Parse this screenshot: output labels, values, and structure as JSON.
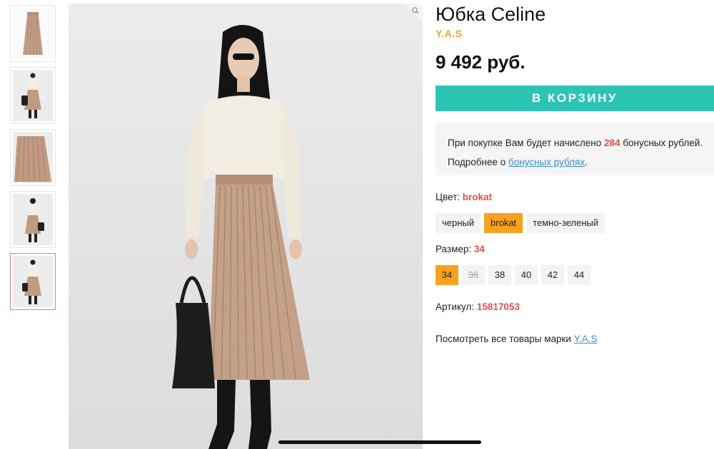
{
  "product": {
    "title": "Юбка Celine",
    "brand": "Y.A.S",
    "price": "9 492 руб.",
    "add_to_cart": "В КОРЗИНУ"
  },
  "bonus": {
    "line1_prefix": "При покупке Вам будет начислено",
    "points": "284",
    "line1_suffix": "бонусных рублей.",
    "line2_prefix": "Подробнее о",
    "line2_link": "бонусных рублях",
    "line2_suffix": "."
  },
  "color": {
    "label": "Цвет:",
    "selected": "brokat",
    "options": [
      "черный",
      "brokat",
      "темно-зеленый"
    ]
  },
  "size": {
    "label": "Размер:",
    "selected": "34",
    "options": [
      "34",
      "36",
      "38",
      "40",
      "42",
      "44"
    ]
  },
  "article": {
    "label": "Артикул:",
    "value": "15817053"
  },
  "brand_link": {
    "prefix": "Посмотреть все товары марки",
    "link": "Y.A.S"
  },
  "icons": {
    "zoom": "magnifier-icon"
  },
  "colors": {
    "accent_orange": "#f7a21e",
    "cart_teal": "#2ec4b4",
    "value_red": "#d9534f",
    "link_blue": "#3a8ed0"
  }
}
